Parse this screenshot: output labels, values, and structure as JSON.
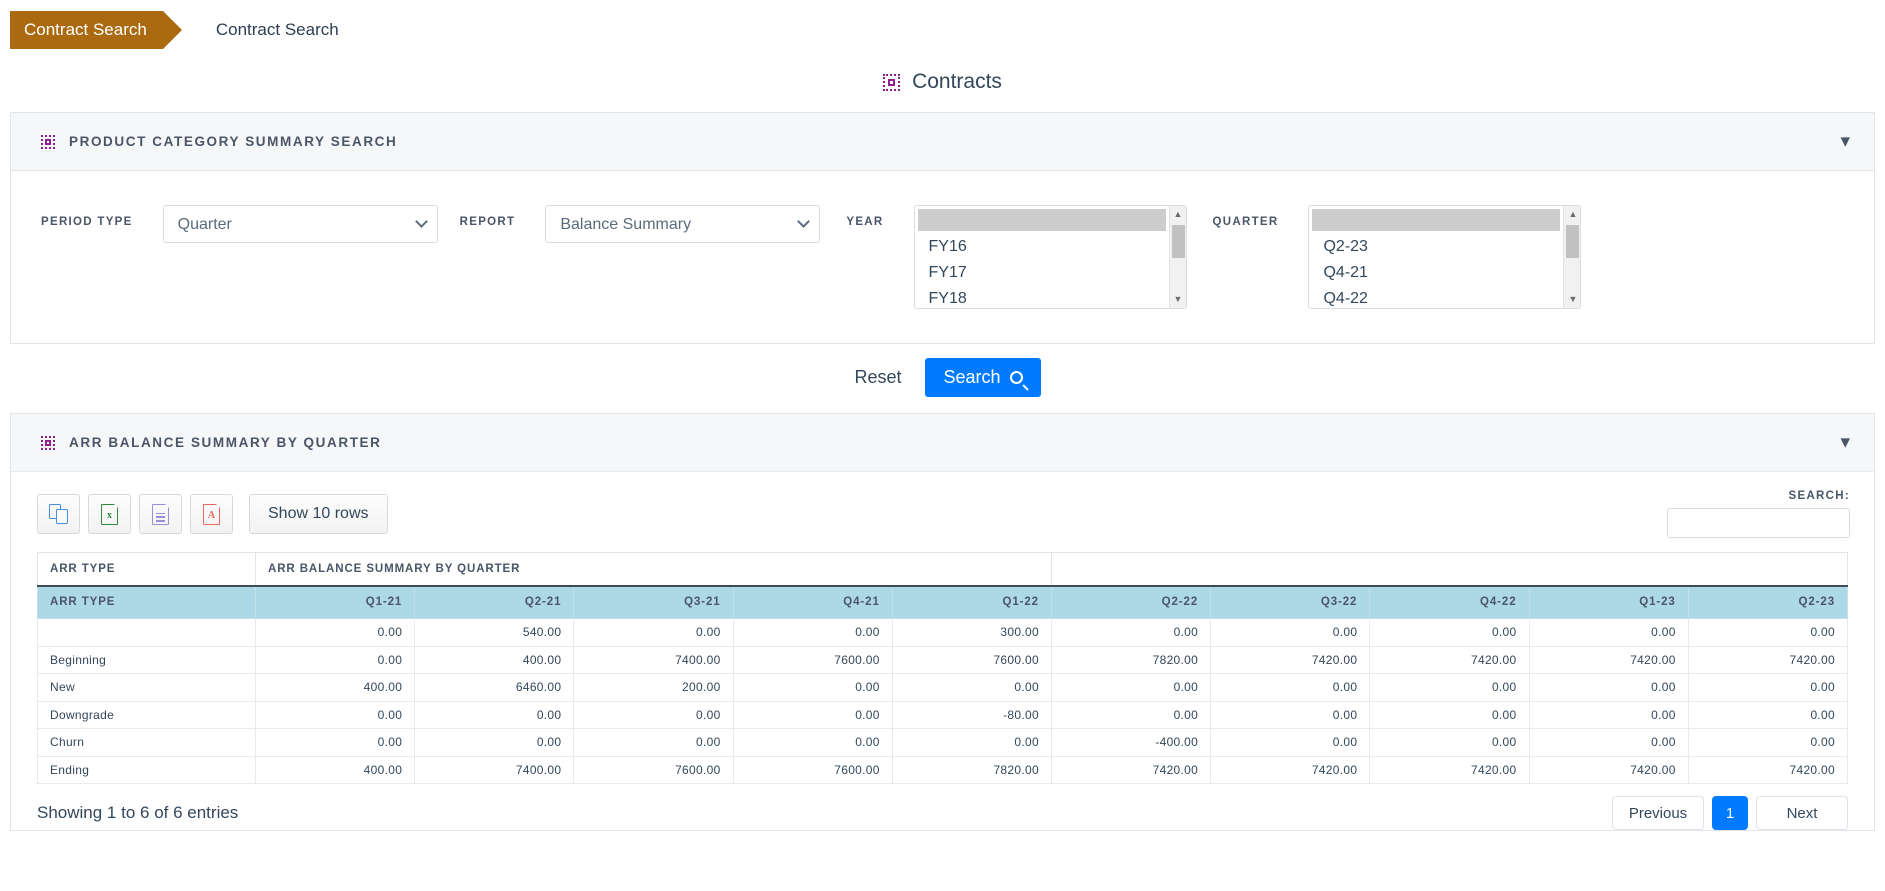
{
  "breadcrumb": {
    "tag": "Contract Search",
    "current": "Contract Search"
  },
  "page": {
    "title": "Contracts",
    "title_icon": "dashed-square-icon"
  },
  "search_panel": {
    "title": "PRODUCT CATEGORY SUMMARY SEARCH",
    "icon": "dashed-square-icon",
    "collapse_icon": "chevron-down-icon",
    "fields": {
      "period_type": {
        "label": "PERIOD TYPE",
        "value": "Quarter",
        "options": [
          "Quarter"
        ]
      },
      "report": {
        "label": "REPORT",
        "value": "Balance Summary",
        "options": [
          "Balance Summary"
        ]
      },
      "year": {
        "label": "YEAR",
        "selected": "",
        "options": [
          "",
          "FY16",
          "FY17",
          "FY18"
        ]
      },
      "quarter": {
        "label": "QUARTER",
        "selected": "",
        "options": [
          "",
          "Q2-23",
          "Q4-21",
          "Q4-22"
        ]
      }
    },
    "reset_label": "Reset",
    "search_label": "Search",
    "search_icon": "magnifier-icon"
  },
  "results_panel": {
    "title": "ARR BALANCE SUMMARY BY QUARTER",
    "icon": "dashed-square-icon",
    "collapse_icon": "chevron-down-icon",
    "toolbar": {
      "copy_icon": "copy-icon",
      "excel_icon": "excel-icon",
      "excel_letter": "x",
      "csv_icon": "csv-document-icon",
      "pdf_icon": "pdf-icon",
      "pdf_letter": "A",
      "show_rows_label": "Show 10 rows"
    },
    "search": {
      "label": "SEARCH:",
      "value": "",
      "placeholder": ""
    },
    "table": {
      "group_header": {
        "row_label": "ARR TYPE",
        "group_label": "ARR BALANCE SUMMARY BY QUARTER"
      },
      "columns": [
        "ARR TYPE",
        "Q1-21",
        "Q2-21",
        "Q3-21",
        "Q4-21",
        "Q1-22",
        "Q2-22",
        "Q3-22",
        "Q4-22",
        "Q1-23",
        "Q2-23"
      ],
      "rows": [
        [
          "",
          "0.00",
          "540.00",
          "0.00",
          "0.00",
          "300.00",
          "0.00",
          "0.00",
          "0.00",
          "0.00",
          "0.00"
        ],
        [
          "Beginning",
          "0.00",
          "400.00",
          "7400.00",
          "7600.00",
          "7600.00",
          "7820.00",
          "7420.00",
          "7420.00",
          "7420.00",
          "7420.00"
        ],
        [
          "New",
          "400.00",
          "6460.00",
          "200.00",
          "0.00",
          "0.00",
          "0.00",
          "0.00",
          "0.00",
          "0.00",
          "0.00"
        ],
        [
          "Downgrade",
          "0.00",
          "0.00",
          "0.00",
          "0.00",
          "-80.00",
          "0.00",
          "0.00",
          "0.00",
          "0.00",
          "0.00"
        ],
        [
          "Churn",
          "0.00",
          "0.00",
          "0.00",
          "0.00",
          "0.00",
          "-400.00",
          "0.00",
          "0.00",
          "0.00",
          "0.00"
        ],
        [
          "Ending",
          "400.00",
          "7400.00",
          "7600.00",
          "7600.00",
          "7820.00",
          "7420.00",
          "7420.00",
          "7420.00",
          "7420.00",
          "7420.00"
        ]
      ]
    },
    "footer": {
      "entries": "Showing 1 to 6 of 6 entries",
      "previous_label": "Previous",
      "page_label": "1",
      "next_label": "Next"
    }
  },
  "colors": {
    "breadcrumb_tag": "#ac6a10",
    "accent_blue": "#007bff",
    "icon_purple": "#8e1f8e",
    "table_header": "#add8e6"
  }
}
